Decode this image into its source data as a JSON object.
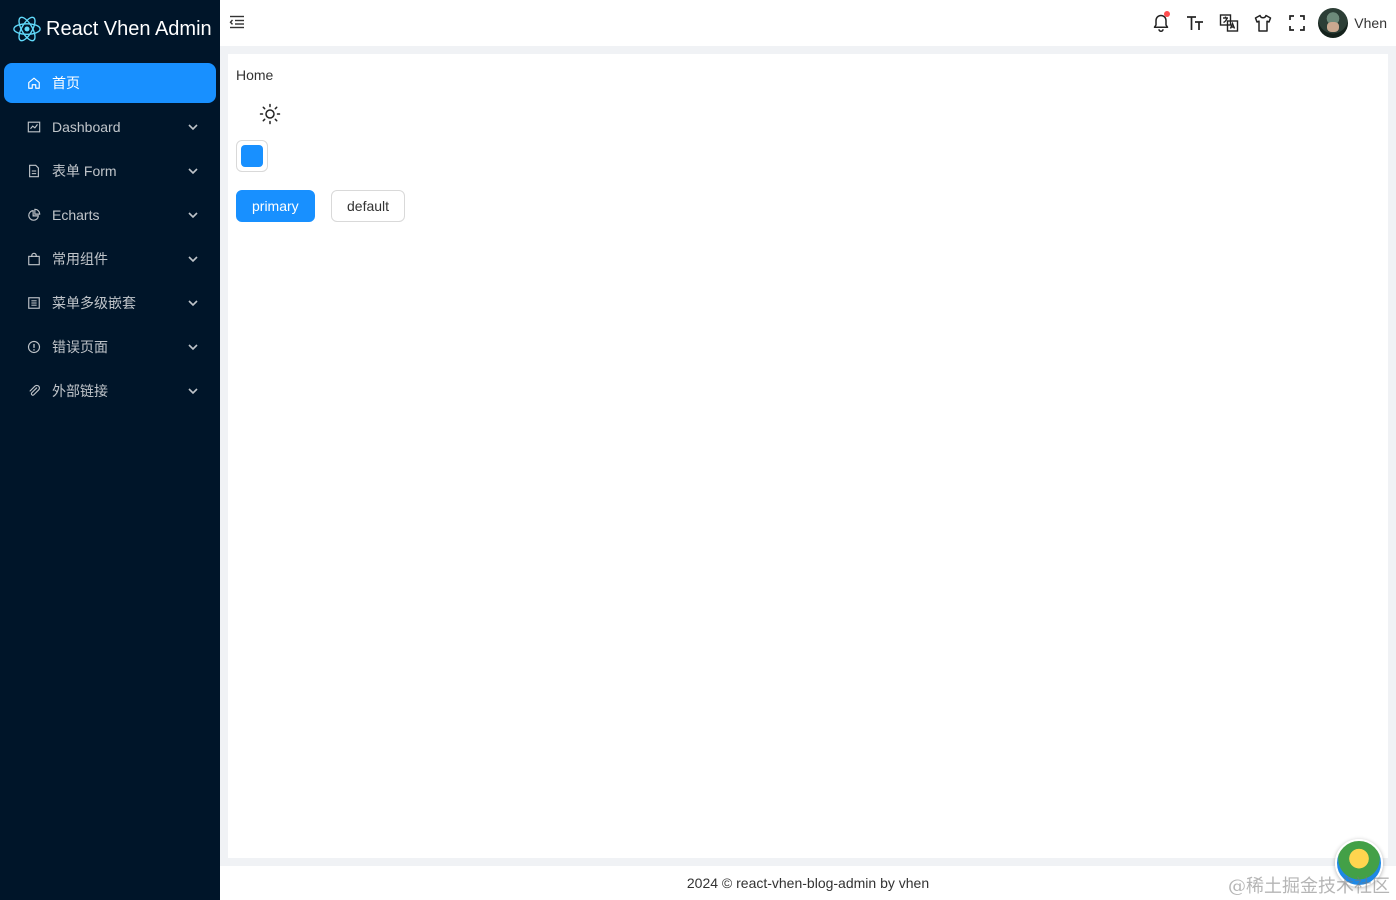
{
  "app": {
    "title": "React Vhen Admin"
  },
  "sidebar": {
    "items": [
      {
        "label": "首页",
        "icon": "home-icon",
        "active": true,
        "expandable": false
      },
      {
        "label": "Dashboard",
        "icon": "dashboard-icon",
        "active": false,
        "expandable": true
      },
      {
        "label": "表单 Form",
        "icon": "form-icon",
        "active": false,
        "expandable": true
      },
      {
        "label": "Echarts",
        "icon": "pie-chart-icon",
        "active": false,
        "expandable": true
      },
      {
        "label": "常用组件",
        "icon": "shopping-bag-icon",
        "active": false,
        "expandable": true
      },
      {
        "label": "菜单多级嵌套",
        "icon": "list-icon",
        "active": false,
        "expandable": true
      },
      {
        "label": "错误页面",
        "icon": "exclamation-icon",
        "active": false,
        "expandable": true
      },
      {
        "label": "外部链接",
        "icon": "paperclip-icon",
        "active": false,
        "expandable": true
      }
    ]
  },
  "header": {
    "tools": [
      "bell-icon",
      "font-size-icon",
      "translate-icon",
      "skin-icon",
      "fullscreen-icon"
    ],
    "notification_dot": true,
    "user": {
      "name": "Vhen"
    }
  },
  "main": {
    "breadcrumb": "Home",
    "theme_color": "#1890ff",
    "buttons": {
      "primary_label": "primary",
      "default_label": "default"
    }
  },
  "footer": {
    "text": "2024 © react-vhen-blog-admin by vhen"
  },
  "watermark": "@稀土掘金技术社区",
  "colors": {
    "sidebar_bg": "#001529",
    "accent": "#1890ff",
    "notification": "#ff4d4f"
  }
}
